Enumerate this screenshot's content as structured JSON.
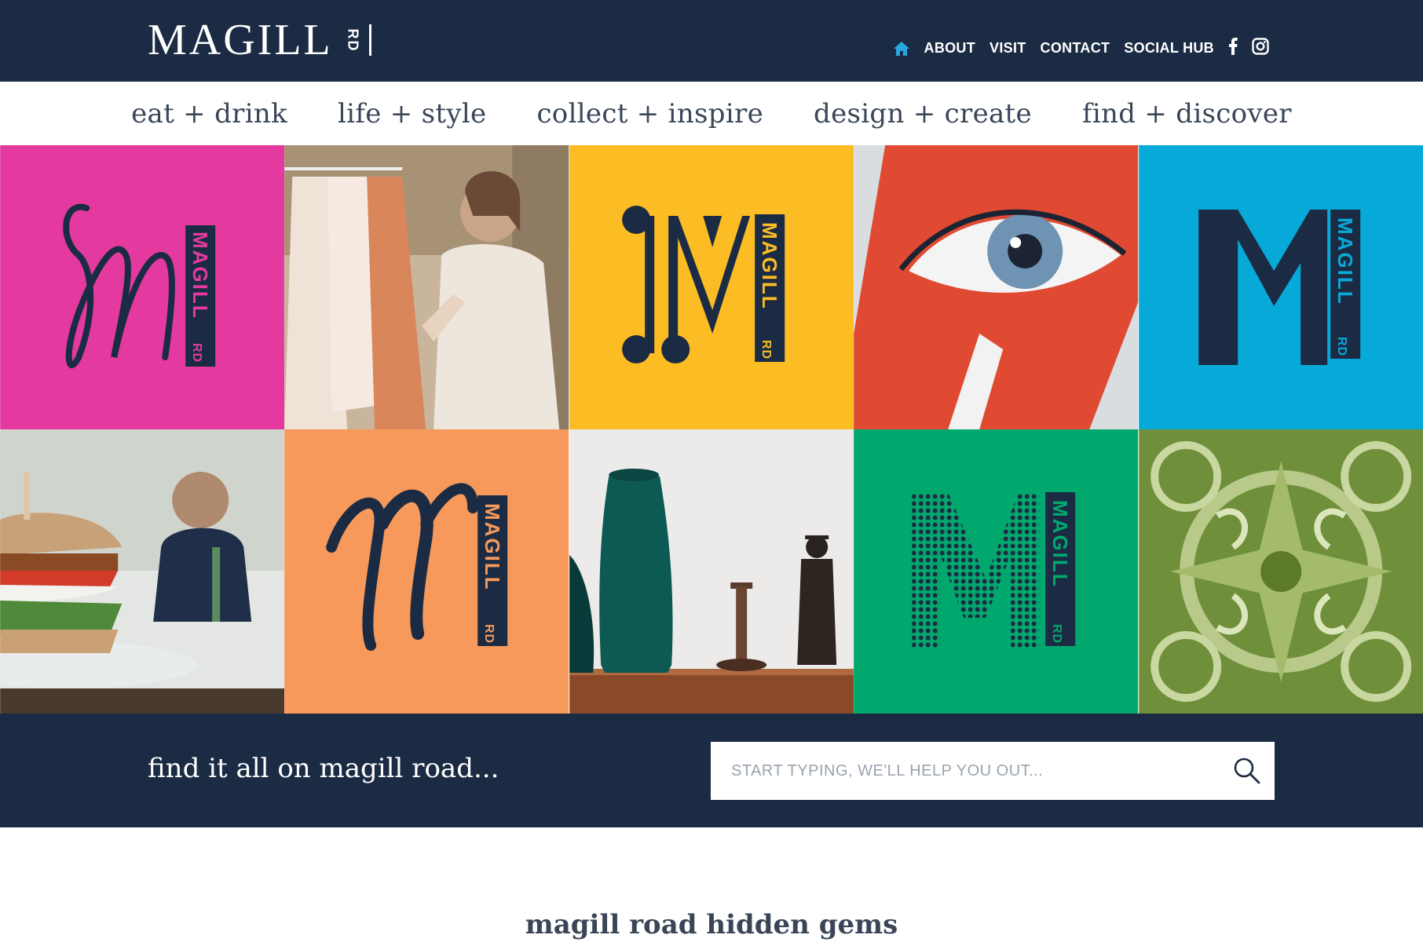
{
  "header": {
    "logo": {
      "word": "MAGILL",
      "suffix": "RD"
    },
    "nav": [
      {
        "label": "ABOUT"
      },
      {
        "label": "VISIT"
      },
      {
        "label": "CONTACT"
      },
      {
        "label": "SOCIAL HUB"
      }
    ],
    "icons": [
      "home-icon",
      "facebook-icon",
      "instagram-icon"
    ]
  },
  "categories": [
    {
      "label": "eat + drink"
    },
    {
      "label": "life + style"
    },
    {
      "label": "collect + inspire"
    },
    {
      "label": "design + create"
    },
    {
      "label": "find + discover"
    }
  ],
  "tiles": {
    "badge_text": "MAGILL",
    "badge_suffix": "RD",
    "colors": {
      "pink": "#e4399f",
      "yellow": "#fbbc24",
      "blue": "#07a9d8",
      "orange": "#f6995a",
      "green": "#01a86d",
      "navy": "#1c2b44"
    }
  },
  "search": {
    "tagline": "find it all on magill road...",
    "placeholder": "START TYPING, WE'LL HELP YOU OUT..."
  },
  "section": {
    "title": "magill road hidden gems"
  },
  "colors": {
    "header_bg": "#1c2b44",
    "accent_home": "#27a7e1"
  }
}
